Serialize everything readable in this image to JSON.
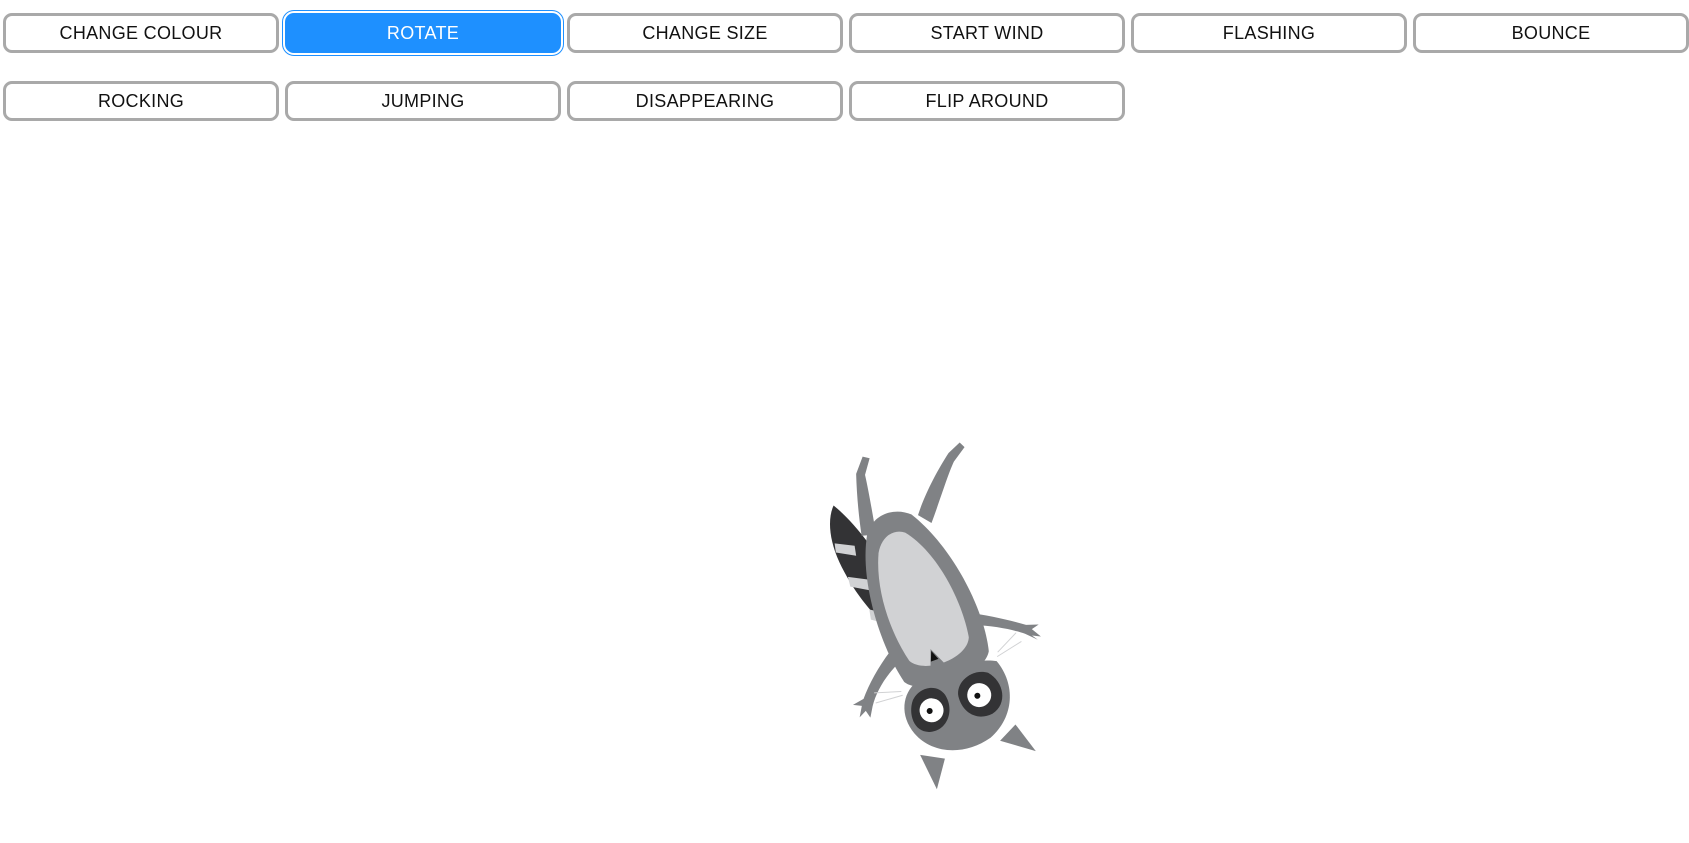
{
  "buttons": [
    {
      "label": "CHANGE COLOUR",
      "active": false
    },
    {
      "label": "ROTATE",
      "active": true
    },
    {
      "label": "CHANGE SIZE",
      "active": false
    },
    {
      "label": "START WIND",
      "active": false
    },
    {
      "label": "FLASHING",
      "active": false
    },
    {
      "label": "BOUNCE",
      "active": false
    },
    {
      "label": "ROCKING",
      "active": false
    },
    {
      "label": "JUMPING",
      "active": false
    },
    {
      "label": "DISAPPEARING",
      "active": false
    },
    {
      "label": "FLIP AROUND",
      "active": false
    }
  ],
  "colors": {
    "button_border": "#a9a9a9",
    "active_button": "#1e90ff",
    "raccoon_body": "#808285",
    "raccoon_belly": "#d1d2d4",
    "raccoon_dark": "#333335"
  },
  "sprite": {
    "icon": "raccoon-sprite",
    "rotation_deg": 160
  }
}
